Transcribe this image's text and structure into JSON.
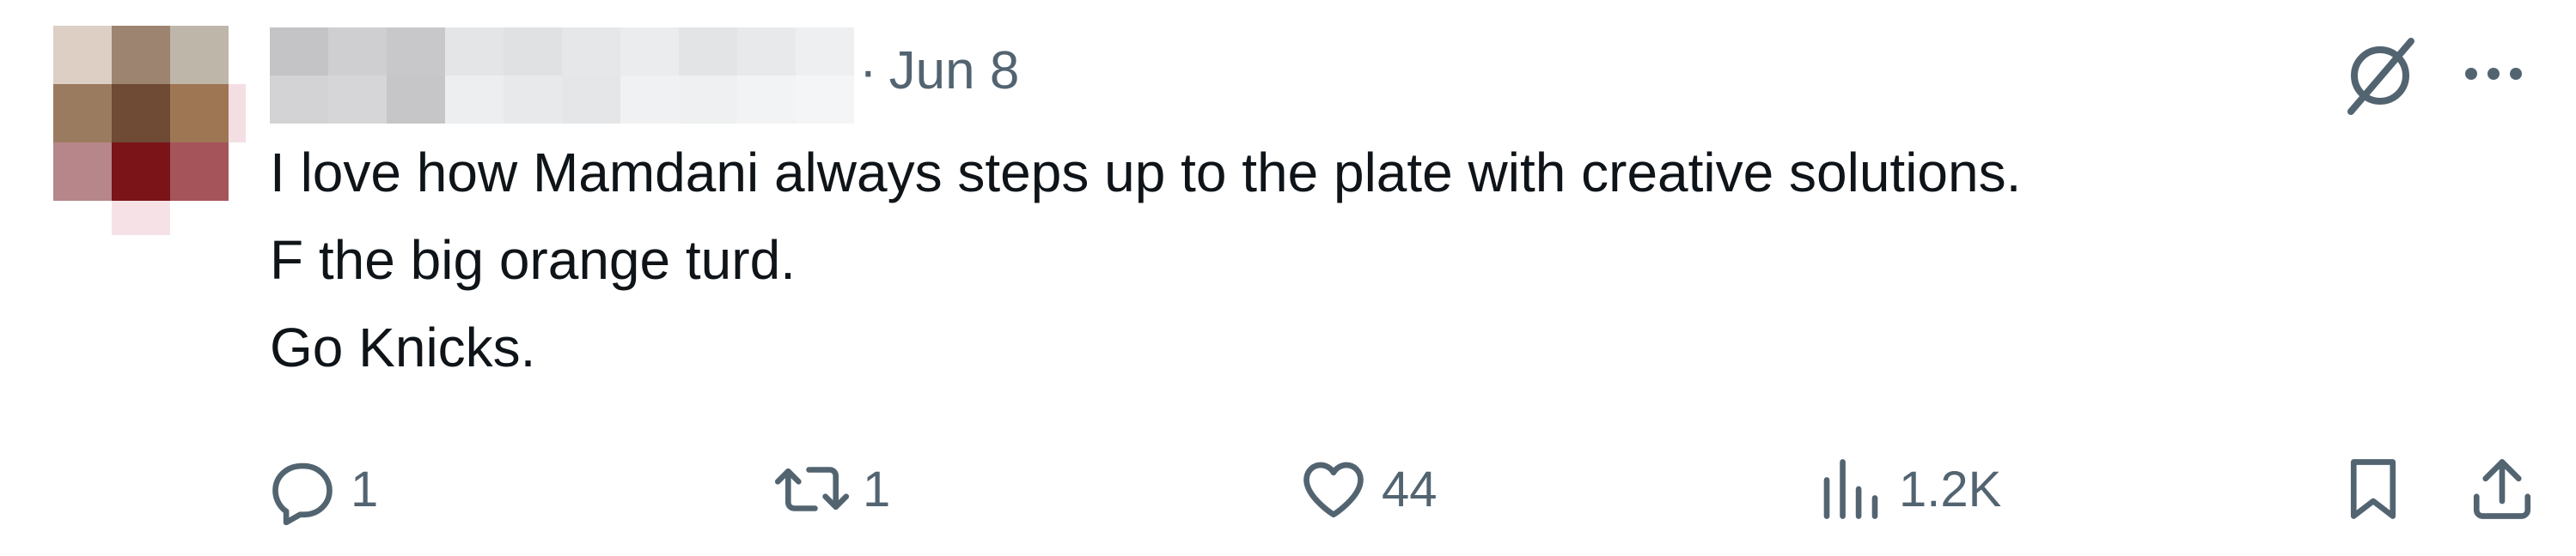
{
  "tweet": {
    "date": "Jun 8",
    "separator": "·",
    "text_lines": [
      "I love how Mamdani always steps up to the plate with creative solutions.",
      "F the big orange turd.",
      "Go Knicks."
    ]
  },
  "actions": {
    "reply_count": "1",
    "retweet_count": "1",
    "like_count": "44",
    "views_count": "1.2K"
  },
  "icons": {
    "reply": "reply-icon",
    "retweet": "retweet-icon",
    "like": "heart-icon",
    "views": "views-icon",
    "bookmark": "bookmark-icon",
    "share": "share-icon",
    "grok": "grok-icon",
    "more": "more-icon"
  },
  "colors": {
    "text": "#0f1419",
    "secondary": "#536471",
    "background": "#ffffff"
  }
}
